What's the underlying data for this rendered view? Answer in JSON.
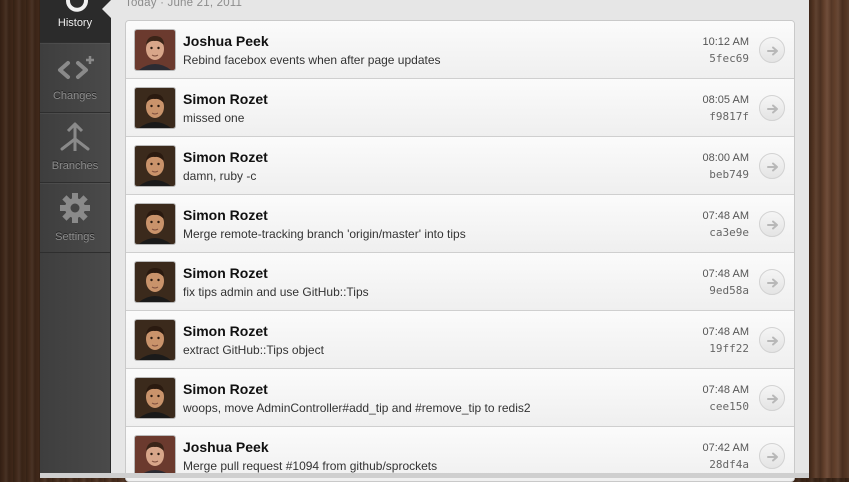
{
  "sidebar": {
    "items": [
      {
        "label": "History",
        "icon": "history-icon",
        "active": true
      },
      {
        "label": "Changes",
        "icon": "changes-icon",
        "active": false
      },
      {
        "label": "Branches",
        "icon": "branches-icon",
        "active": false
      },
      {
        "label": "Settings",
        "icon": "gear-icon",
        "active": false
      }
    ]
  },
  "date_header": "Today · June 21, 2011",
  "commits": [
    {
      "author": "Joshua Peek",
      "message": "Rebind facebox events when after page updates",
      "time": "10:12 AM",
      "sha": "5fec69",
      "avatar": "joshua"
    },
    {
      "author": "Simon Rozet",
      "message": "missed one",
      "time": "08:05 AM",
      "sha": "f9817f",
      "avatar": "simon"
    },
    {
      "author": "Simon Rozet",
      "message": "damn, ruby -c",
      "time": "08:00 AM",
      "sha": "beb749",
      "avatar": "simon"
    },
    {
      "author": "Simon Rozet",
      "message": "Merge remote-tracking branch 'origin/master' into tips",
      "time": "07:48 AM",
      "sha": "ca3e9e",
      "avatar": "simon"
    },
    {
      "author": "Simon Rozet",
      "message": "fix tips admin and use GitHub::Tips",
      "time": "07:48 AM",
      "sha": "9ed58a",
      "avatar": "simon"
    },
    {
      "author": "Simon Rozet",
      "message": "extract GitHub::Tips object",
      "time": "07:48 AM",
      "sha": "19ff22",
      "avatar": "simon"
    },
    {
      "author": "Simon Rozet",
      "message": "woops, move AdminController#add_tip and #remove_tip to redis2",
      "time": "07:48 AM",
      "sha": "cee150",
      "avatar": "simon"
    },
    {
      "author": "Joshua Peek",
      "message": "Merge pull request #1094 from github/sprockets",
      "time": "07:42 AM",
      "sha": "28df4a",
      "avatar": "joshua"
    }
  ],
  "colors": {
    "sidebar": "#444444",
    "sidebar_active": "#2b2b2b",
    "list_bg": "#f6f6f6"
  }
}
